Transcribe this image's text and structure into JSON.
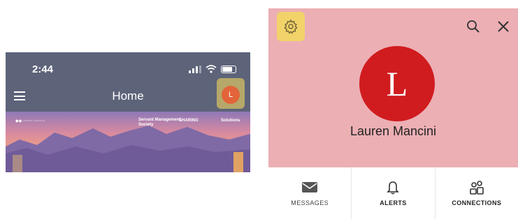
{
  "phone": {
    "status_time": "2:44",
    "title": "Home",
    "avatar_initial": "L",
    "sponsors": [
      "Servant Management",
      "Society",
      "SHARING",
      "Solutions"
    ]
  },
  "profile": {
    "avatar_initial": "L",
    "user_name": "Lauren Mancini",
    "nav": [
      {
        "label": "MESSAGES",
        "icon": "envelope-icon"
      },
      {
        "label": "ALERTS",
        "icon": "bell-icon"
      },
      {
        "label": "CONNECTIONS",
        "icon": "people-icon"
      }
    ]
  },
  "colors": {
    "phone_header": "#5d6379",
    "avatar_small": "#e2643a",
    "avatar_highlight": "#b6a86a",
    "profile_background": "#ecafb4",
    "settings_highlight": "#f2d36a",
    "avatar_big": "#d01c1f"
  }
}
